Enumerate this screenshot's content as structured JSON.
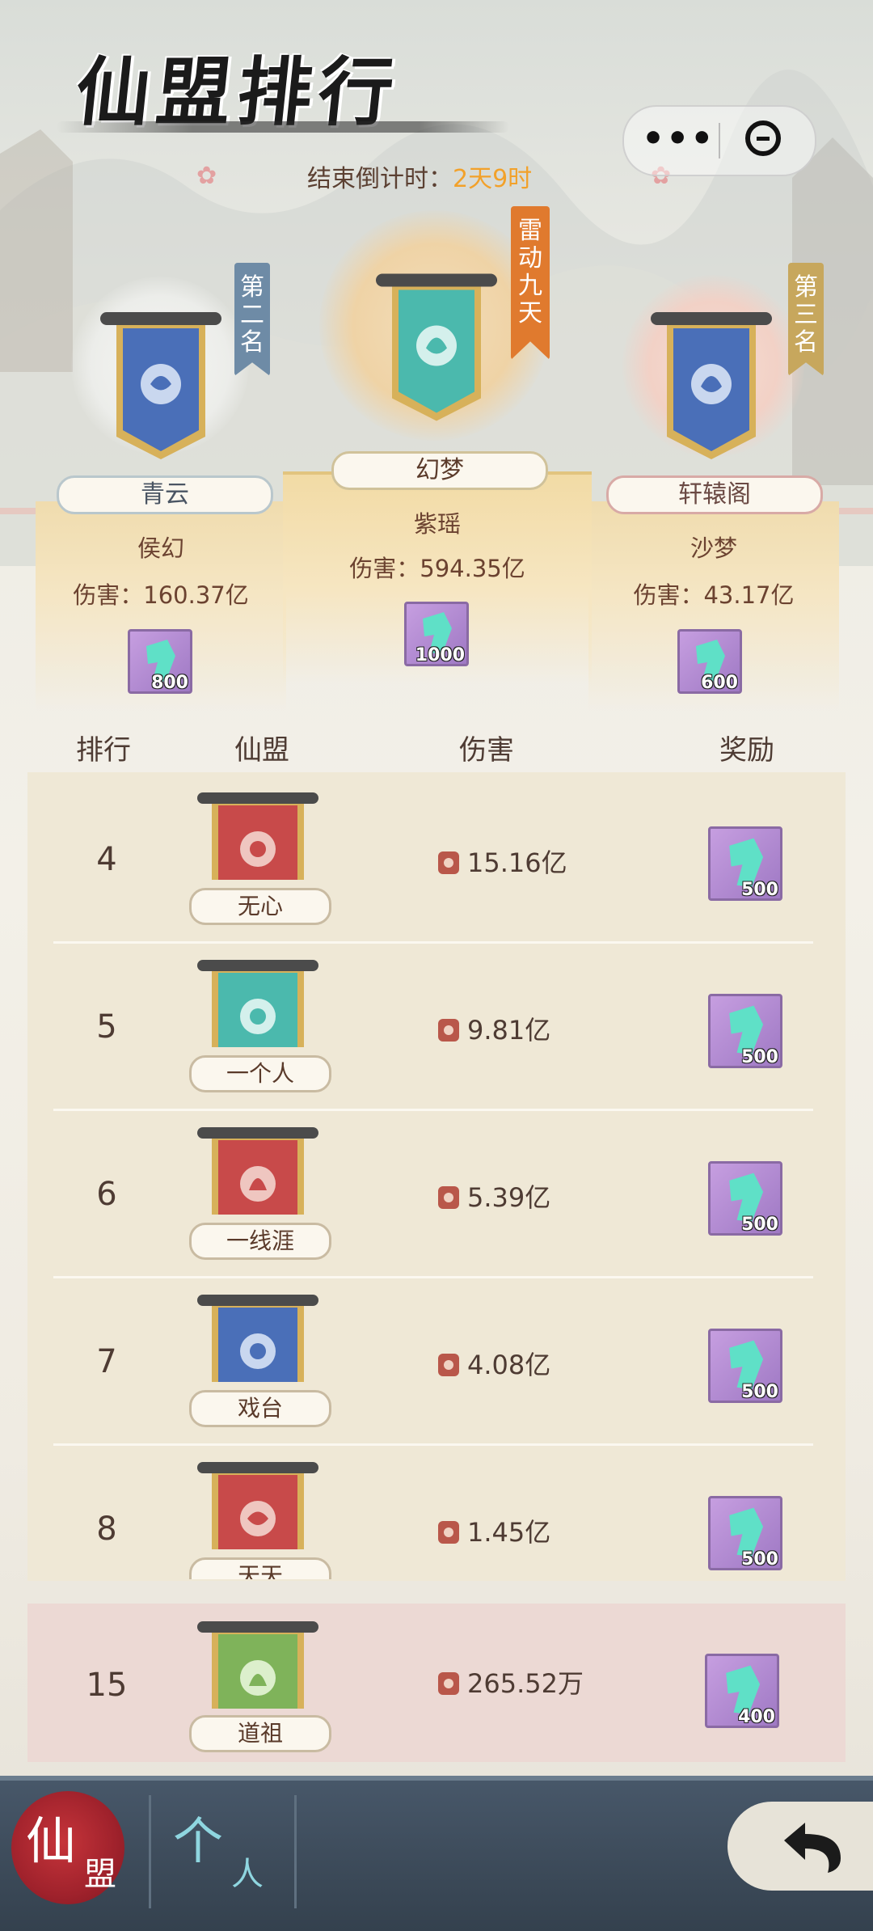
{
  "header": {
    "title": "仙盟排行",
    "countdown_label": "结束倒计时：",
    "countdown_value": "2天9时"
  },
  "capsule": {
    "more_glyph": "•••",
    "close_icon": "minus-circle-icon"
  },
  "podium": {
    "first": {
      "rank_label": "雷动九天",
      "guild": "幻梦",
      "leader": "紫瑶",
      "damage": "伤害：594.35亿",
      "reward_count": "1000",
      "emblem_color": "#4bb9ad"
    },
    "second": {
      "rank_label": "第二名",
      "guild": "青云",
      "leader": "侯幻",
      "damage": "伤害：160.37亿",
      "reward_count": "800",
      "emblem_color": "#4a6fb8"
    },
    "third": {
      "rank_label": "第三名",
      "guild": "轩辕阁",
      "leader": "沙梦",
      "damage": "伤害：43.17亿",
      "reward_count": "600",
      "emblem_color": "#4a6fb8"
    }
  },
  "table": {
    "headers": {
      "rank": "排行",
      "guild": "仙盟",
      "damage": "伤害",
      "reward": "奖励"
    },
    "rows": [
      {
        "rank": "4",
        "guild": "无心",
        "damage": "15.16亿",
        "reward": "500",
        "color": "#c84a4a"
      },
      {
        "rank": "5",
        "guild": "一个人",
        "damage": "9.81亿",
        "reward": "500",
        "color": "#4bb9ad"
      },
      {
        "rank": "6",
        "guild": "一线涯",
        "damage": "5.39亿",
        "reward": "500",
        "color": "#c84a4a"
      },
      {
        "rank": "7",
        "guild": "戏台",
        "damage": "4.08亿",
        "reward": "500",
        "color": "#4a6fb8"
      },
      {
        "rank": "8",
        "guild": "天天",
        "damage": "1.45亿",
        "reward": "500",
        "color": "#c84a4a"
      }
    ],
    "mine": {
      "rank": "15",
      "guild": "道祖",
      "damage": "265.52万",
      "reward": "400",
      "color": "#7fb35a"
    }
  },
  "bottom_tabs": {
    "alliance_a": "仙",
    "alliance_b": "盟",
    "personal_a": "个",
    "personal_b": "人",
    "back_icon": "back-arrow-icon"
  }
}
